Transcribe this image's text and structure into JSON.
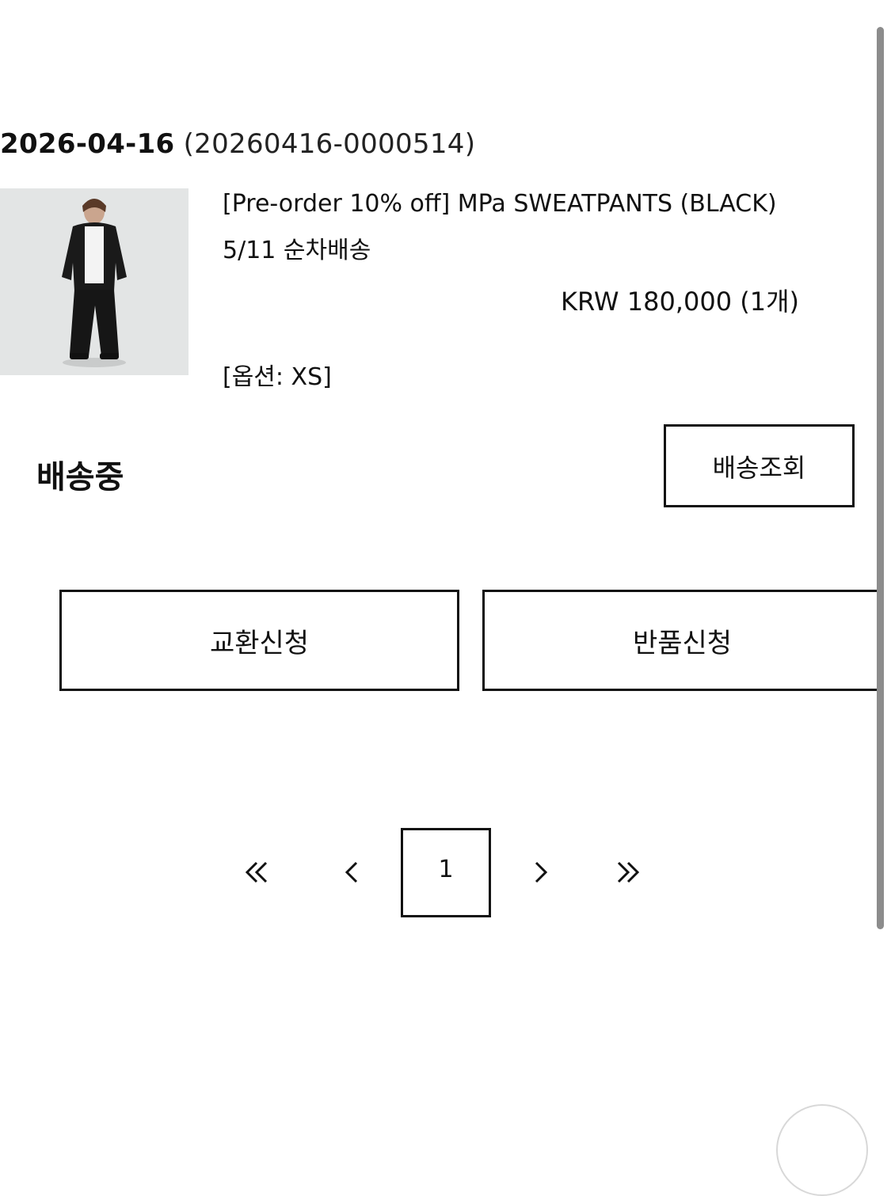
{
  "order": {
    "date": "2026-04-16",
    "number": "(20260416-0000514)"
  },
  "product": {
    "name": "[Pre-order 10% off] MPa SWEATPANTS (BLACK)",
    "shipping_note": "5/11 순차배송",
    "price": "KRW 180,000 (1개)",
    "option": "[옵션: XS]"
  },
  "status": {
    "label": "배송중",
    "track_button": "배송조회"
  },
  "actions": {
    "exchange": "교환신청",
    "return": "반품신청"
  },
  "pagination": {
    "current_page": "1"
  },
  "icons": {
    "first": "double-chevron-left-icon",
    "prev": "chevron-left-icon",
    "next": "chevron-right-icon",
    "last": "double-chevron-right-icon"
  }
}
